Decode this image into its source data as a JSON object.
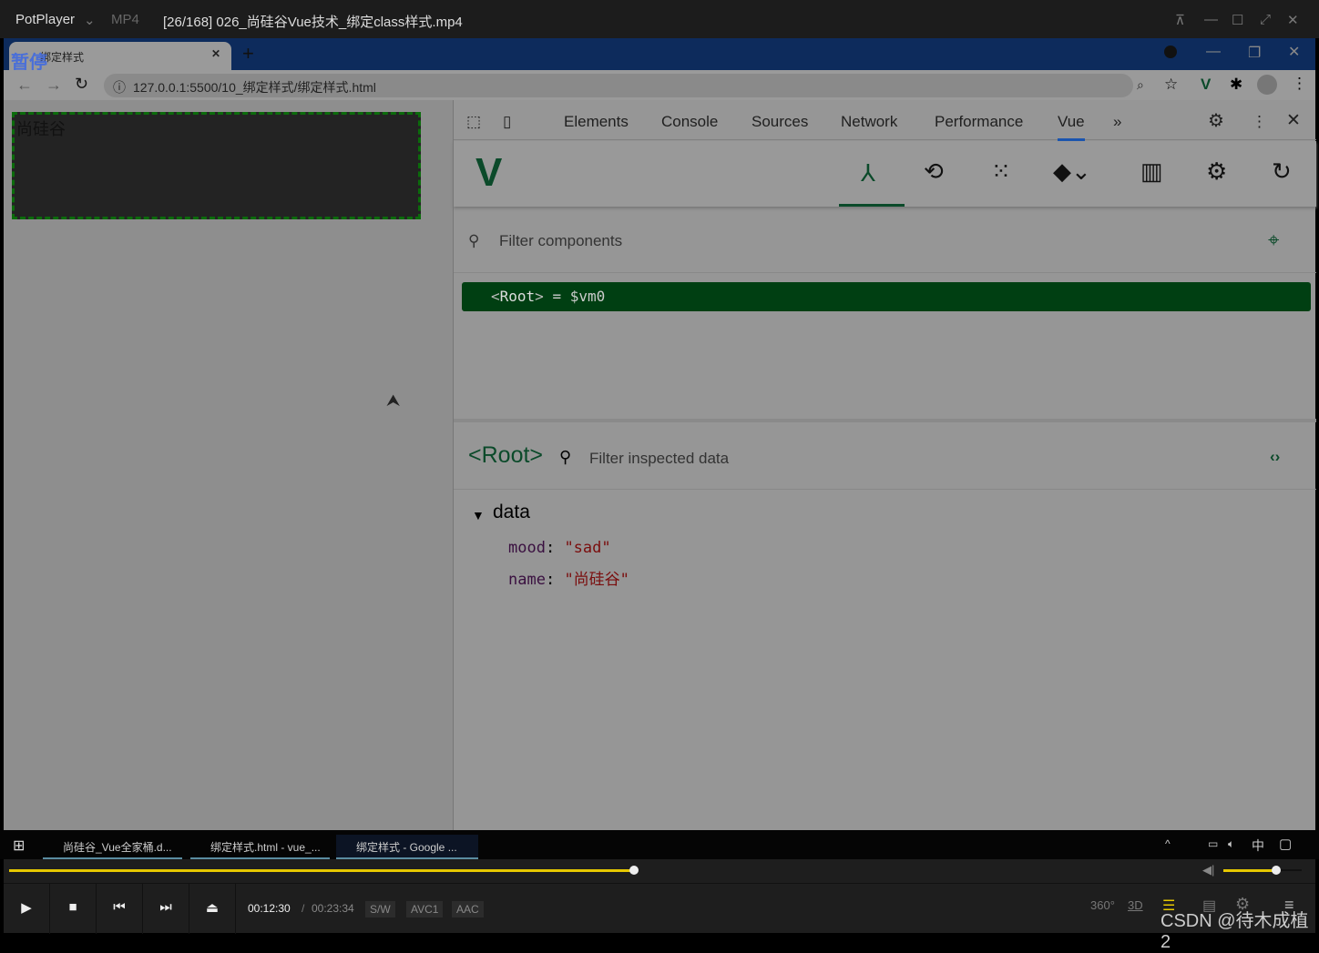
{
  "player": {
    "app": "PotPlayer",
    "format": "MP4",
    "title": "[26/168] 026_尚硅谷Vue技术_绑定class样式.mp4",
    "paused_overlay": "暂停",
    "time_current": "00:12:30",
    "time_total": "00:23:34",
    "badges": [
      "S/W",
      "AVC1",
      "AAC"
    ],
    "progress": 0.53,
    "volume": 0.68,
    "watermark": "CSDN @待木成植2",
    "icons": [
      "360-icon",
      "3d-icon",
      "playlist-icon",
      "subtitle-icon",
      "settings-icon",
      "menu-icon"
    ]
  },
  "browser": {
    "tab_title": "绑定样式",
    "url": "127.0.0.1:5500/10_绑定样式/绑定样式.html"
  },
  "page": {
    "box_text": "尚硅谷"
  },
  "devtools": {
    "tabs": [
      "Elements",
      "Console",
      "Sources",
      "Network",
      "Performance",
      "Vue"
    ],
    "active_tab": "Vue",
    "filter_placeholder": "Filter components",
    "root_tag": "Root",
    "root_assign": "= $vm0",
    "inspected_title": "Root",
    "inspect_placeholder": "Filter inspected data",
    "section": "data",
    "fields": [
      {
        "key": "mood",
        "value": "\"sad\""
      },
      {
        "key": "name",
        "value": "\"尚硅谷\""
      }
    ]
  },
  "taskbar": {
    "items": [
      "尚硅谷_Vue全家桶.d...",
      "绑定样式.html - vue_...",
      "绑定样式 - Google ..."
    ],
    "ime": "中"
  },
  "colors": {
    "vue_green": "#0b4a2a",
    "accent_yellow": "#e6c800"
  }
}
